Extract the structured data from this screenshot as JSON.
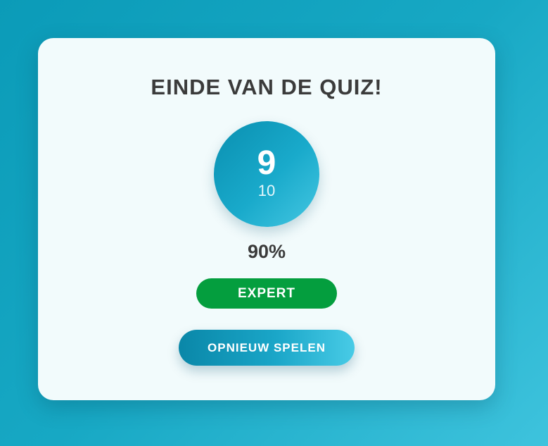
{
  "quiz_result": {
    "title": "EINDE VAN DE QUIZ!",
    "score": "9",
    "total": "10",
    "percentage": "90%",
    "level": "EXPERT",
    "replay_label": "OPNIEUW SPELEN"
  },
  "colors": {
    "background_start": "#0b9bb8",
    "background_end": "#3ec3dd",
    "card_background": "#f2fbfc",
    "text_dark": "#3b3b3b",
    "level_badge": "#049e3e",
    "accent": "#19aacb"
  }
}
